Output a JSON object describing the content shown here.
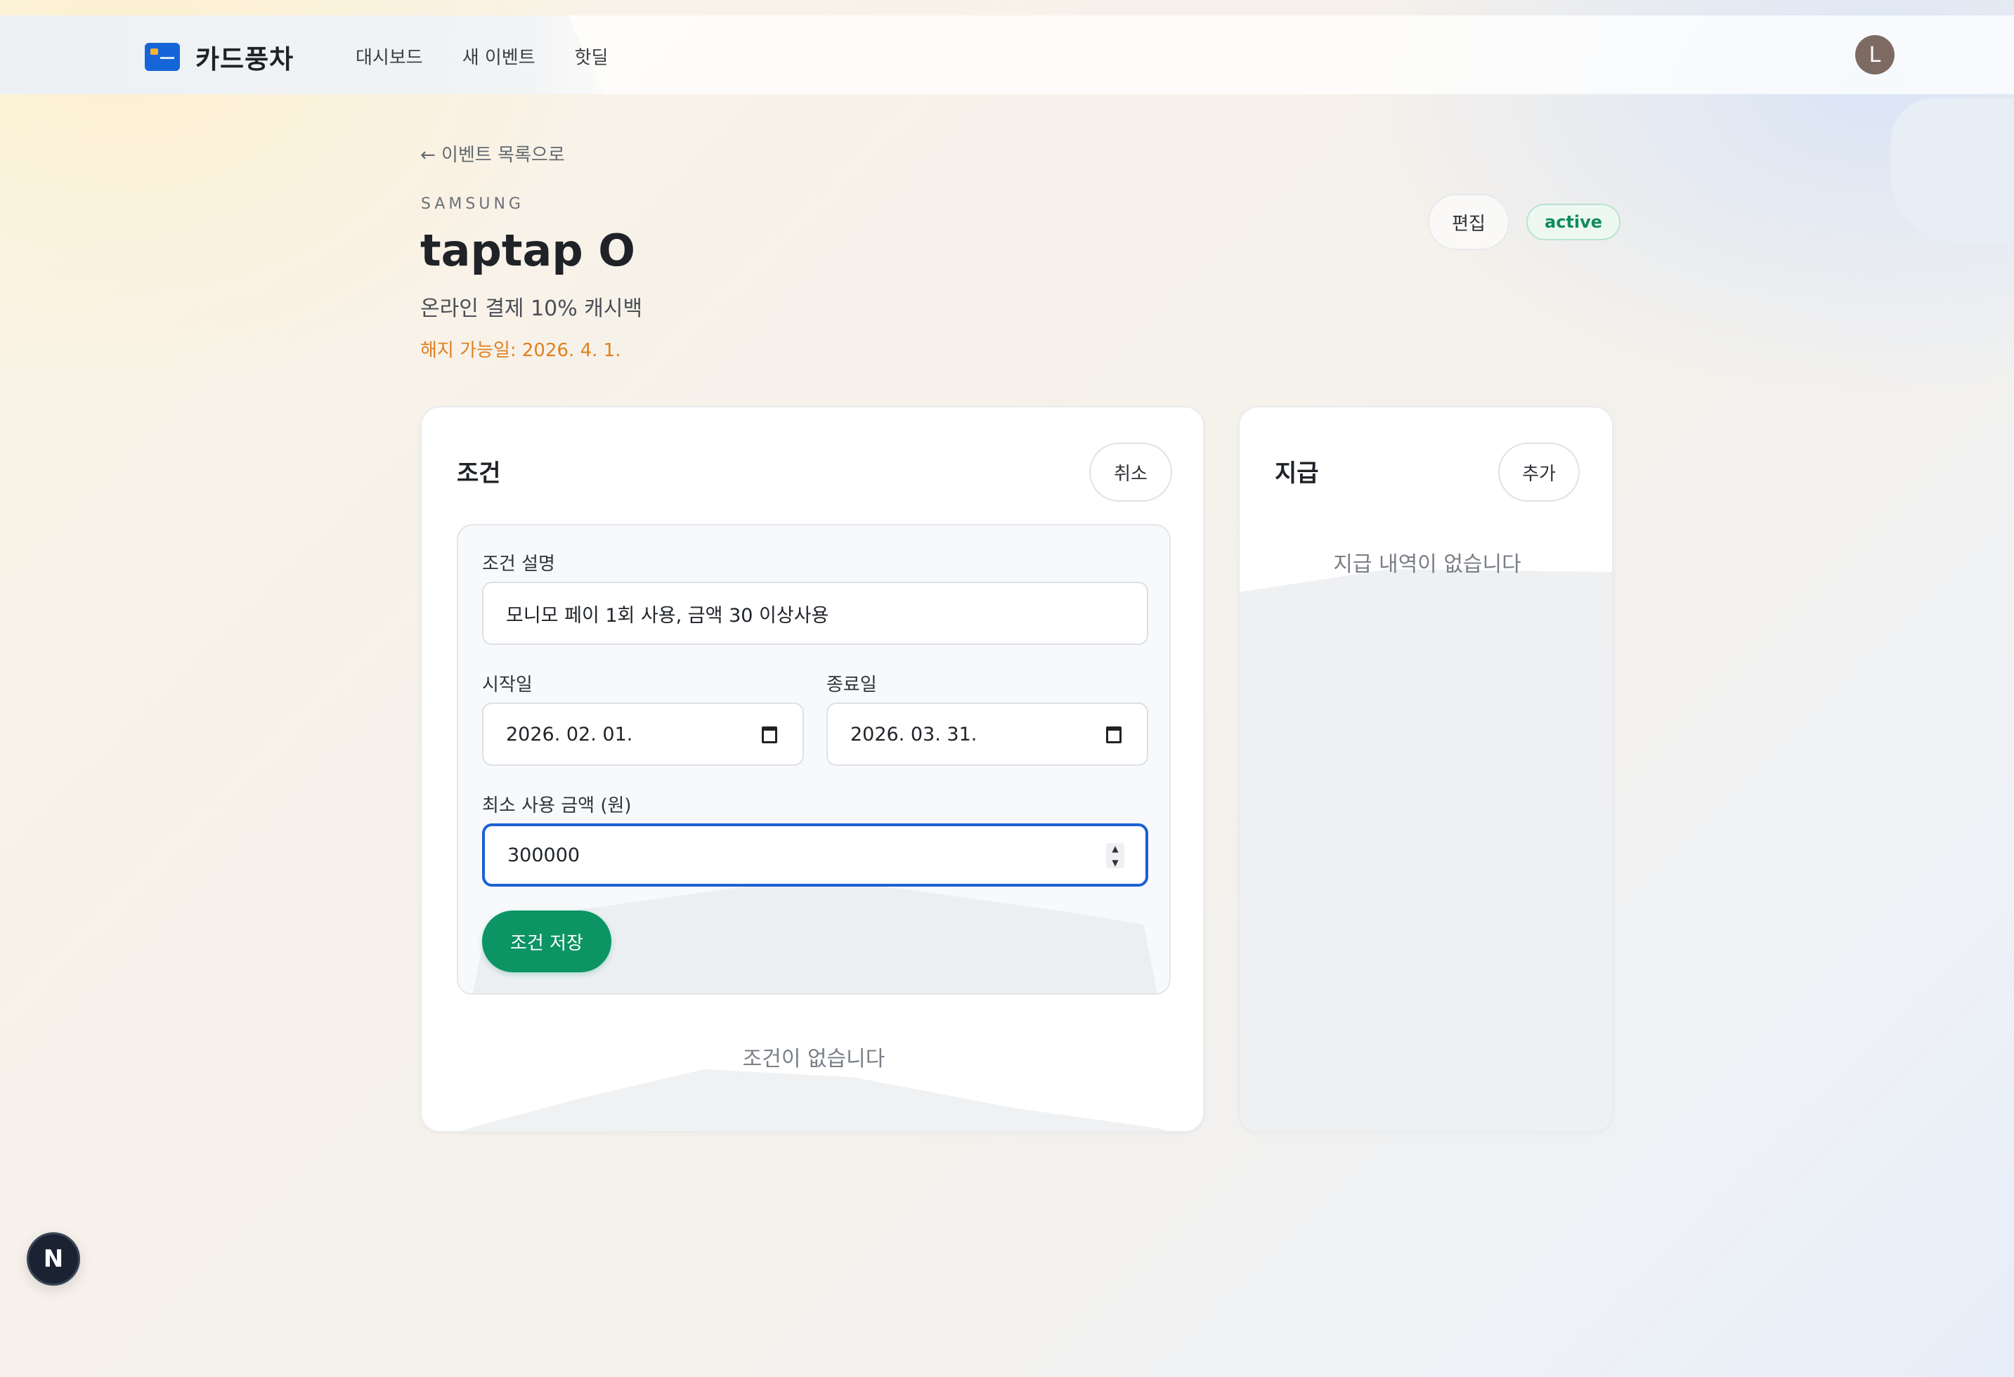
{
  "app": {
    "name": "카드풍차",
    "avatar_initial": "L",
    "nav": [
      "대시보드",
      "새 이벤트",
      "핫딜"
    ]
  },
  "event": {
    "back_label": "← 이벤트 목록으로",
    "issuer": "SAMSUNG",
    "title": "taptap O",
    "subtitle": "온라인 결제 10% 캐시백",
    "cancel_date": "해지 가능일: 2026. 4. 1.",
    "edit_label": "편집",
    "status": "active"
  },
  "conditions": {
    "title": "조건",
    "cancel_label": "취소",
    "form": {
      "description_label": "조건 설명",
      "description_value": "모니모 페이 1회 사용, 금액 30 이상사용",
      "start_label": "시작일",
      "start_value": "2026. 02. 01.",
      "end_label": "종료일",
      "end_value": "2026. 03. 31.",
      "min_amount_label": "최소 사용 금액 (원)",
      "min_amount_value": "300000",
      "save_label": "조건 저장"
    },
    "empty_text": "조건이 없습니다"
  },
  "payments": {
    "title": "지급",
    "add_label": "추가",
    "empty_text": "지급 내역이 없습니다"
  },
  "dev_badge": "N",
  "colors": {
    "accent_blue": "#1d5fd6",
    "primary_green": "#0c9464",
    "warning_orange": "#e0801f",
    "status_green": "#0f8a5f"
  }
}
